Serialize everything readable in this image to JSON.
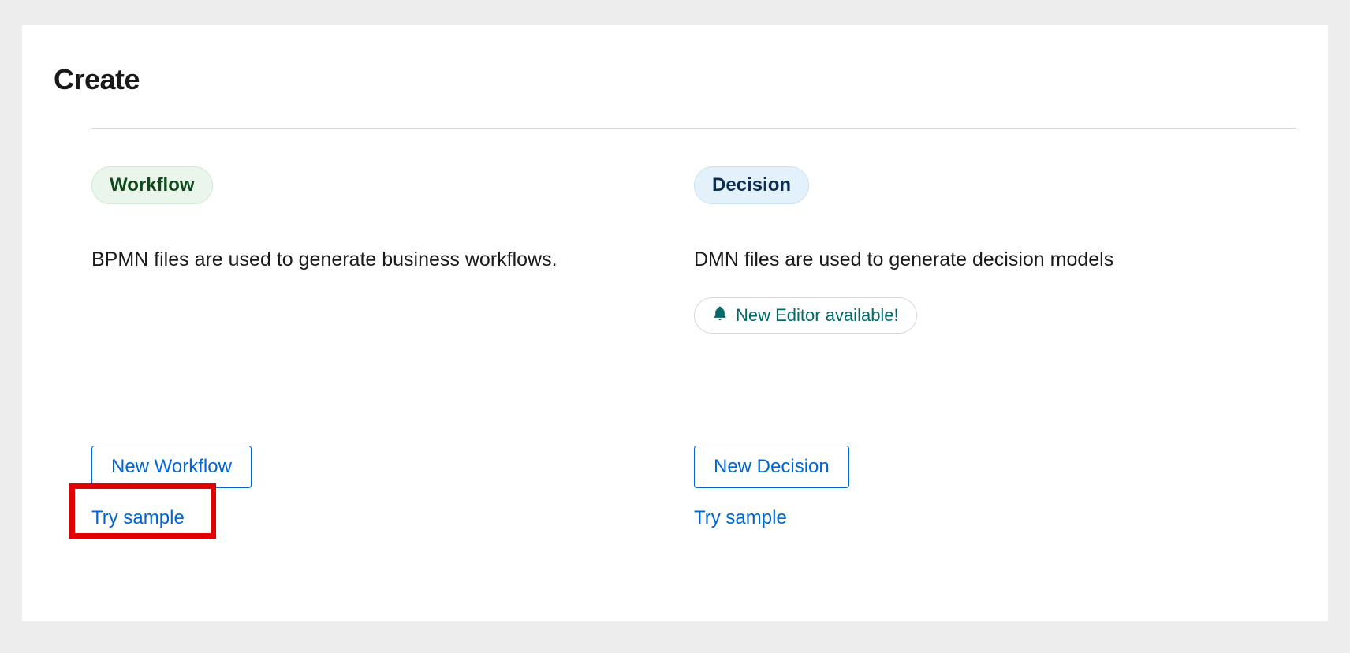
{
  "page": {
    "title": "Create"
  },
  "workflow": {
    "tag": "Workflow",
    "description": "BPMN files are used to generate business workflows.",
    "new_button": "New Workflow",
    "try_sample": "Try sample"
  },
  "decision": {
    "tag": "Decision",
    "description": "DMN files are used to generate decision models",
    "notice": "New Editor available!",
    "new_button": "New Decision",
    "try_sample": "Try sample"
  },
  "colors": {
    "link": "#0066d4",
    "workflow_tag_bg": "#eaf6ec",
    "workflow_tag_fg": "#0f4a1a",
    "decision_tag_bg": "#e3f1fb",
    "decision_tag_fg": "#0b2e56",
    "notice_fg": "#006a6a",
    "highlight": "#e30000"
  },
  "icons": {
    "bell": "bell-icon"
  }
}
